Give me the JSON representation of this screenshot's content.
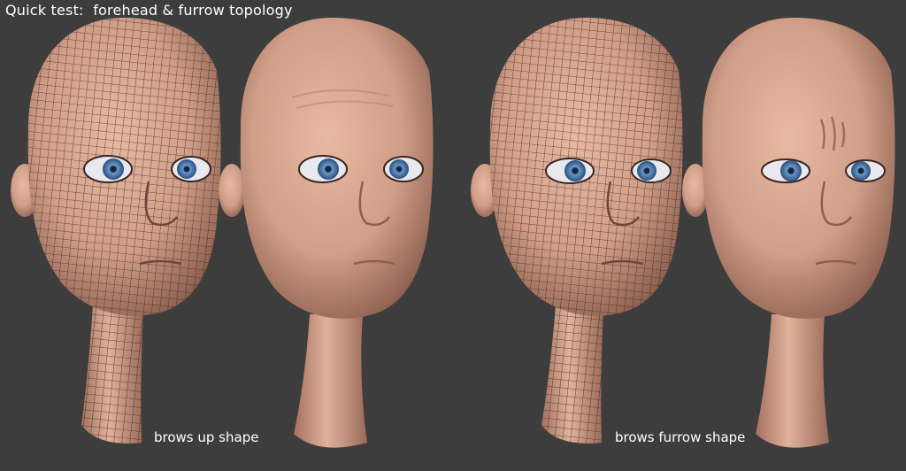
{
  "title": "Quick test:  forehead & furrow topology",
  "captions": {
    "left": "brows up shape",
    "right": "brows furrow shape"
  },
  "colors": {
    "background": "#3d3d3d",
    "skin": "#d9a78f",
    "skin_shadow": "#9a6b5a",
    "iris": "#4f7db3",
    "wire": "#2a1c18"
  }
}
